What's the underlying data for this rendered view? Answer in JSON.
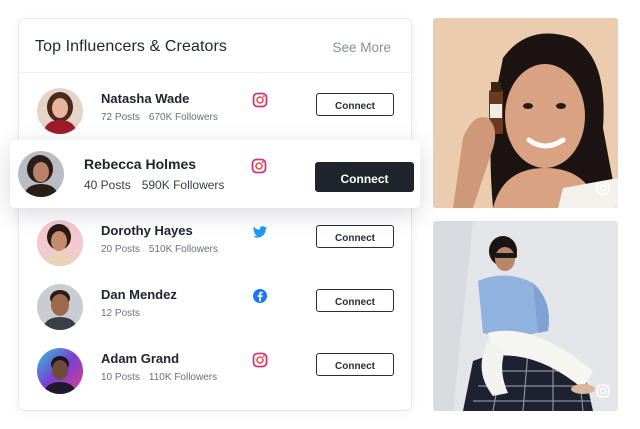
{
  "panel": {
    "title": "Top Influencers & Creators",
    "see_more": "See More"
  },
  "influencers": [
    {
      "name": "Natasha Wade",
      "posts": "72 Posts",
      "followers": "670K Followers",
      "platform": "instagram-icon",
      "action": "Connect"
    },
    {
      "name": "Rebecca Holmes",
      "posts": "40 Posts",
      "followers": "590K Followers",
      "platform": "instagram-icon",
      "action": "Connect",
      "highlighted": true
    },
    {
      "name": "Dorothy Hayes",
      "posts": "20 Posts",
      "followers": "510K Followers",
      "platform": "twitter-icon",
      "action": "Connect"
    },
    {
      "name": "Dan Mendez",
      "posts": "12 Posts",
      "followers": "",
      "platform": "facebook-icon",
      "action": "Connect"
    },
    {
      "name": "Adam Grand",
      "posts": "10 Posts",
      "followers": "110K Followers",
      "platform": "instagram-icon",
      "action": "Connect"
    }
  ],
  "colors": {
    "instagram": "#d6337d",
    "twitter": "#1d9bf0",
    "facebook": "#1877f2",
    "primary_button": "#20242d"
  }
}
